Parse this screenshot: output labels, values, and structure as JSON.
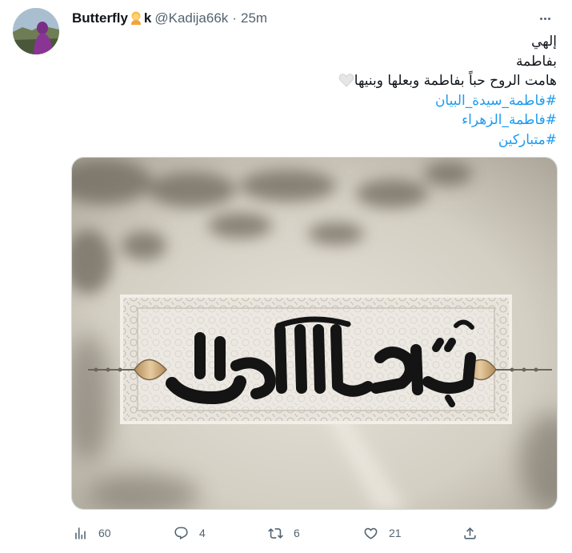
{
  "tweet": {
    "display_name_part1": "Butterfly",
    "display_name_part2": "k",
    "emoji_name": "person-blond-emoji",
    "handle": "@Kadija66k",
    "separator": "·",
    "time": "25m",
    "text_lines": [
      "إلهي",
      "بفاطمة",
      "هامت الروح حباً بفاطمة وبعلها وبنيها"
    ],
    "hashtags": [
      "#فاطمة_سيدة_البيان",
      "#فاطمة_الزهراء",
      "#متباركين"
    ],
    "heart_emoji": "white-heart-emoji",
    "media_alt_text": "بسم الله النور"
  },
  "actions": {
    "views": "60",
    "replies": "4",
    "retweets": "6",
    "likes": "21"
  },
  "colors": {
    "link": "#1d9bf0",
    "muted": "#536471",
    "text": "#0f1419"
  }
}
